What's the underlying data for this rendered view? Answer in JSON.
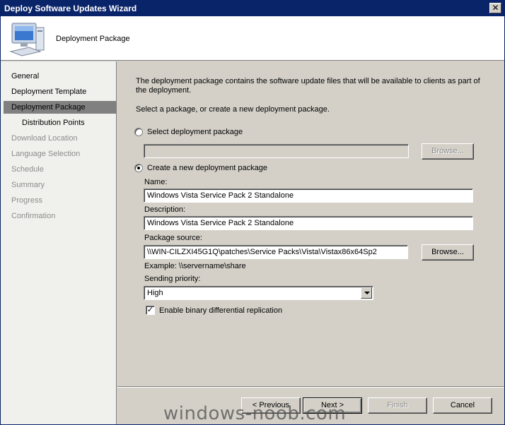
{
  "window": {
    "title": "Deploy Software Updates Wizard",
    "close_glyph": "✕"
  },
  "header": {
    "title": "Deployment Package",
    "icon": "computer-icon"
  },
  "sidebar": {
    "items": [
      {
        "label": "General",
        "state": "enabled"
      },
      {
        "label": "Deployment Template",
        "state": "enabled"
      },
      {
        "label": "Deployment Package",
        "state": "active"
      },
      {
        "label": "Distribution Points",
        "state": "enabled",
        "sub": true
      },
      {
        "label": "Download Location",
        "state": "disabled"
      },
      {
        "label": "Language Selection",
        "state": "disabled"
      },
      {
        "label": "Schedule",
        "state": "disabled"
      },
      {
        "label": "Summary",
        "state": "disabled"
      },
      {
        "label": "Progress",
        "state": "disabled"
      },
      {
        "label": "Confirmation",
        "state": "disabled"
      }
    ]
  },
  "main": {
    "intro": "The deployment package contains the software update files that will be available to clients as part of the deployment.",
    "select_prompt": "Select a package, or create a new deployment package.",
    "select_existing_label": "Select deployment package",
    "select_existing_value": "",
    "browse_disabled_label": "Browse...",
    "create_new_label": "Create a new deployment package",
    "name_label": "Name:",
    "name_value": "Windows Vista Service Pack 2 Standalone",
    "description_label": "Description:",
    "description_value": "Windows Vista Service Pack 2 Standalone",
    "source_label": "Package source:",
    "source_value": "\\\\WIN-CILZXI45G1Q\\patches\\Service Packs\\Vista\\Vistax86x64Sp2",
    "browse_label": "Browse...",
    "example_text": "Example: \\\\servername\\share",
    "priority_label": "Sending priority:",
    "priority_value": "High",
    "binary_repl_label": "Enable binary differential replication",
    "binary_repl_checked": "✓"
  },
  "footer": {
    "previous_label": "< Previous",
    "next_label": "Next >",
    "finish_label": "Finish",
    "cancel_label": "Cancel"
  },
  "watermark": "windows-noob.com"
}
